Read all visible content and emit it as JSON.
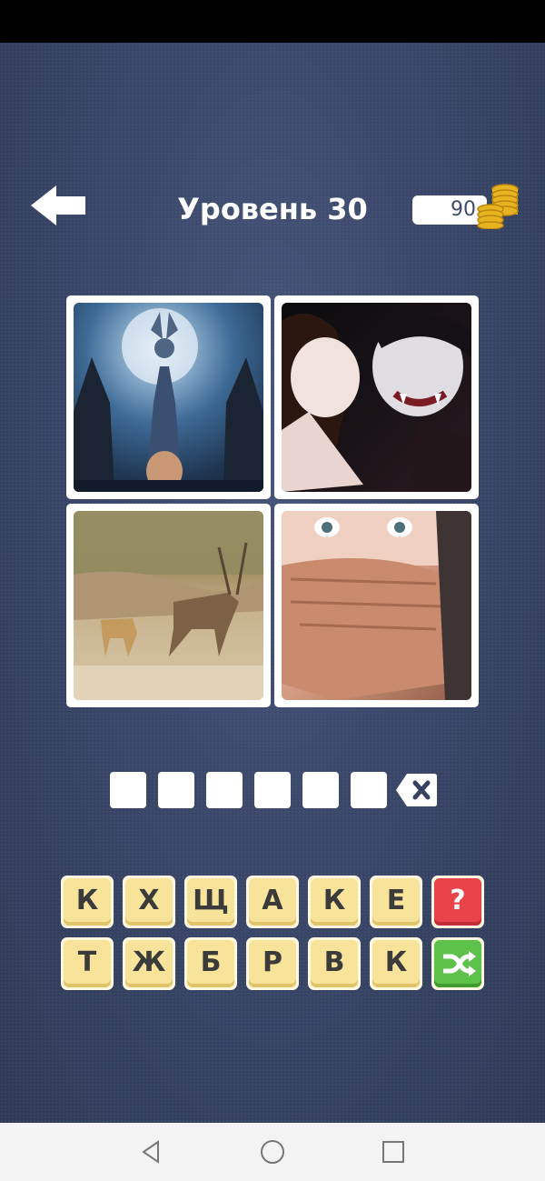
{
  "header": {
    "level_title": "Уровень 30",
    "coins": "90"
  },
  "pictures": [
    {
      "name": "dark-ritual-picture"
    },
    {
      "name": "vampire-bite-picture"
    },
    {
      "name": "antelope-chase-picture"
    },
    {
      "name": "covered-mouth-picture"
    }
  ],
  "answer": {
    "slots": [
      "",
      "",
      "",
      "",
      "",
      ""
    ]
  },
  "keyboard": {
    "row1": [
      "К",
      "Х",
      "Щ",
      "А",
      "К",
      "Е"
    ],
    "row2": [
      "Т",
      "Ж",
      "Б",
      "Р",
      "В",
      "К"
    ],
    "hint_icon": "question-icon",
    "shuffle_icon": "shuffle-icon"
  },
  "colors": {
    "background": "#35415f",
    "key_face": "#f7e39a",
    "hint": "#e8444a",
    "shuffle": "#5cc24a"
  }
}
